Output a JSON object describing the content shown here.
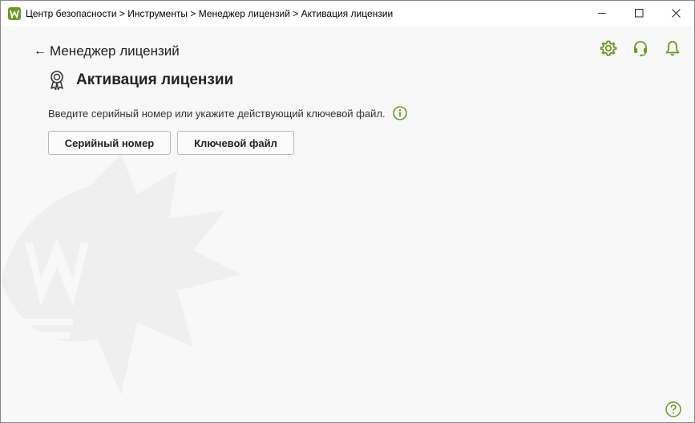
{
  "window": {
    "title": "Центр безопасности > Инструменты > Менеджер лицензий > Активация лицензии",
    "controls": {
      "minimize": "—",
      "maximize": "☐",
      "close": "✕"
    }
  },
  "nav": {
    "back_arrow": "←",
    "back_label": "Менеджер лицензий"
  },
  "header_icons": [
    "gear-icon",
    "headset-icon",
    "bell-icon"
  ],
  "page": {
    "title": "Активация лицензии",
    "description": "Введите серийный номер или укажите действующий ключевой файл."
  },
  "buttons": {
    "serial": "Серийный номер",
    "keyfile": "Ключевой файл"
  },
  "colors": {
    "accent": "#6a9c1f",
    "background": "#f8f8f8",
    "watermark": "#efefef"
  }
}
